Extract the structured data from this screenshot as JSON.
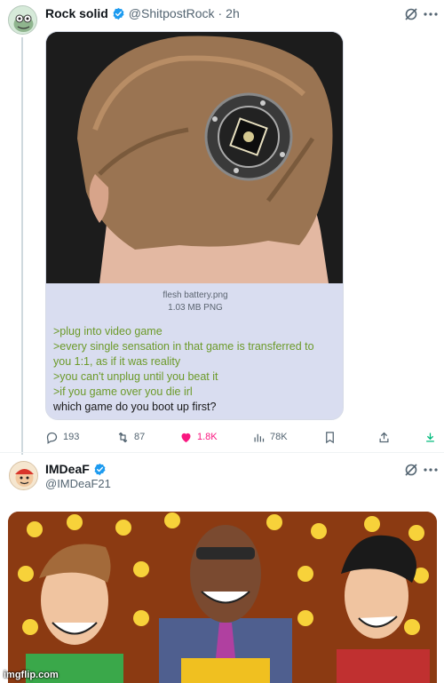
{
  "tweet1": {
    "display_name": "Rock solid",
    "handle": "@ShitpostRock",
    "separator": "·",
    "time": "2h",
    "verified": true,
    "media_card": {
      "image_caption": "brown-haired head from behind with a circular metal port implanted in the back of the skull",
      "file_name": "flesh battery.png",
      "file_meta": "1.03 MB PNG",
      "lines": [
        ">plug into video game",
        ">every single sensation in that game is transferred to",
        "you 1:1, as if it was reality",
        ">you can't unplug until you beat it",
        ">if you game over you die irl",
        "which game do you boot up first?"
      ]
    },
    "actions": {
      "replies": "193",
      "retweets": "87",
      "likes": "1.8K",
      "views": "78K"
    }
  },
  "tweet2": {
    "display_name": "IMDeaF",
    "handle": "@IMDeaF21",
    "verified": true,
    "image_caption": "cartoon game show scene: smiling host in a suit at a podium between two grinning contestants, bright bulb wall behind"
  },
  "watermark": "imgflip.com",
  "colors": {
    "verified": "#1d9bf0",
    "like": "#f91880",
    "download": "#00ba7c",
    "greentext": "#6c9a2a"
  }
}
